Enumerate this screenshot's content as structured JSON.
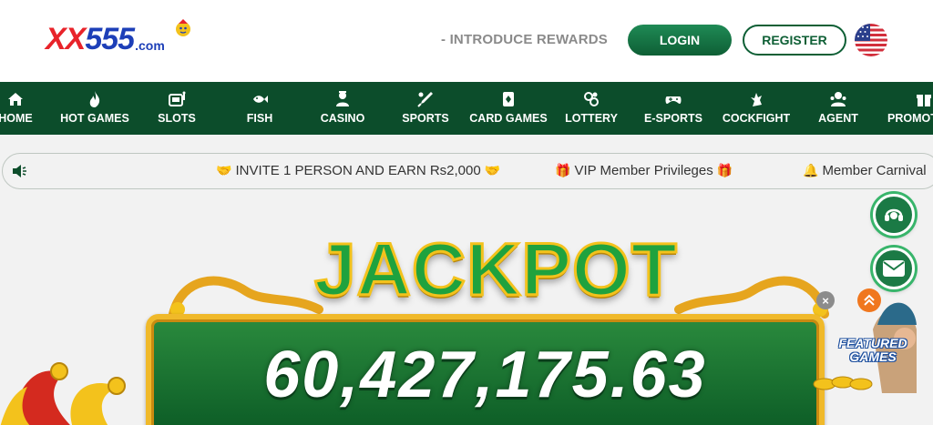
{
  "header": {
    "logo": {
      "part1": "XX",
      "part2": "555",
      "suffix": ".com"
    },
    "intro_link": "- INTRODUCE REWARDS",
    "login_label": "LOGIN",
    "register_label": "REGISTER",
    "language_flag": "us-flag-icon"
  },
  "nav": {
    "items": [
      {
        "label": "HOME",
        "icon": "home-icon"
      },
      {
        "label": "HOT GAMES",
        "icon": "flame-icon"
      },
      {
        "label": "SLOTS",
        "icon": "slot-machine-icon"
      },
      {
        "label": "FISH",
        "icon": "fish-icon"
      },
      {
        "label": "CASINO",
        "icon": "casino-dealer-icon"
      },
      {
        "label": "SPORTS",
        "icon": "cricket-bat-icon"
      },
      {
        "label": "CARD GAMES",
        "icon": "card-icon"
      },
      {
        "label": "LOTTERY",
        "icon": "lottery-balls-icon"
      },
      {
        "label": "E-SPORTS",
        "icon": "gamepad-icon"
      },
      {
        "label": "COCKFIGHT",
        "icon": "rooster-icon"
      },
      {
        "label": "AGENT",
        "icon": "agent-icon"
      },
      {
        "label": "PROMOT",
        "icon": "gift-icon"
      }
    ]
  },
  "marquee": {
    "messages": [
      {
        "text": "INVITE 1 PERSON AND EARN Rs2,000",
        "emoji_left": "🤝",
        "emoji_right": "🤝"
      },
      {
        "text": "VIP Member Privileges",
        "emoji_left": "🎁",
        "emoji_right": "🎁"
      },
      {
        "text": "Member Carnival",
        "emoji_left": "🔔",
        "emoji_right": ""
      }
    ]
  },
  "banner": {
    "title": "JACKPOT",
    "amount": "60,427,175.63"
  },
  "floating": {
    "featured_label_line1": "FEATURED",
    "featured_label_line2": "GAMES",
    "close_label": "×"
  },
  "colors": {
    "brand_green": "#0c4d2b",
    "login_green": "#1f8a55",
    "logo_red": "#e8232a",
    "logo_blue": "#1d3fb8",
    "gold": "#f0b92a"
  }
}
